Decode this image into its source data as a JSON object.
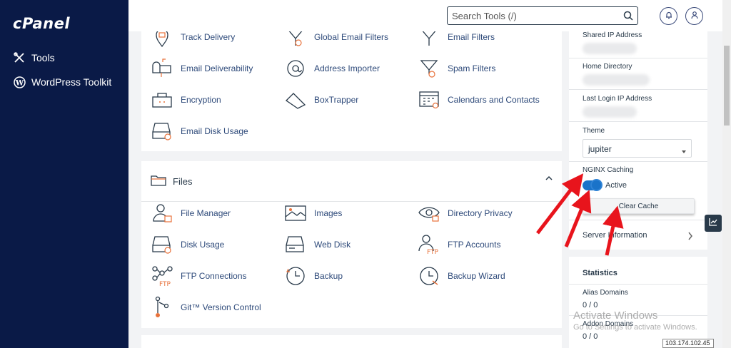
{
  "sidebar": {
    "logo": "cPanel",
    "items": [
      {
        "label": "Tools",
        "icon": "tools-icon"
      },
      {
        "label": "WordPress Toolkit",
        "icon": "wordpress-icon"
      }
    ]
  },
  "header": {
    "search_placeholder": "Search Tools (/)"
  },
  "email_tools": [
    {
      "label": "Track Delivery",
      "icon": "track-delivery-icon"
    },
    {
      "label": "Global Email Filters",
      "icon": "global-email-filters-icon"
    },
    {
      "label": "Email Filters",
      "icon": "email-filters-icon"
    },
    {
      "label": "Email Deliverability",
      "icon": "mailbox-icon"
    },
    {
      "label": "Address Importer",
      "icon": "address-importer-icon"
    },
    {
      "label": "Spam Filters",
      "icon": "spam-filters-icon"
    },
    {
      "label": "Encryption",
      "icon": "encryption-icon"
    },
    {
      "label": "BoxTrapper",
      "icon": "boxtrapper-icon"
    },
    {
      "label": "Calendars and Contacts",
      "icon": "calendar-icon"
    },
    {
      "label": "Email Disk Usage",
      "icon": "disk-usage-icon"
    }
  ],
  "files": {
    "title": "Files",
    "tools": [
      {
        "label": "File Manager",
        "icon": "file-manager-icon"
      },
      {
        "label": "Images",
        "icon": "images-icon"
      },
      {
        "label": "Directory Privacy",
        "icon": "directory-privacy-icon"
      },
      {
        "label": "Disk Usage",
        "icon": "disk-usage-icon"
      },
      {
        "label": "Web Disk",
        "icon": "web-disk-icon"
      },
      {
        "label": "FTP Accounts",
        "icon": "ftp-accounts-icon"
      },
      {
        "label": "FTP Connections",
        "icon": "ftp-connections-icon"
      },
      {
        "label": "Backup",
        "icon": "backup-icon"
      },
      {
        "label": "Backup Wizard",
        "icon": "backup-wizard-icon"
      },
      {
        "label": "Git™ Version Control",
        "icon": "git-icon"
      }
    ]
  },
  "general_info": {
    "shared_ip_label": "Shared IP Address",
    "home_dir_label": "Home Directory",
    "last_login_label": "Last Login IP Address",
    "theme_label": "Theme",
    "theme_value": "jupiter",
    "nginx_label": "NGINX Caching",
    "nginx_status": "Active",
    "clear_cache_label": "Clear Cache",
    "server_info_label": "Server Information"
  },
  "statistics": {
    "title": "Statistics",
    "items": [
      {
        "label": "Alias Domains",
        "value": "0 / 0"
      },
      {
        "label": "Addon Domains",
        "value": "0 / 0"
      }
    ]
  },
  "watermark": {
    "line1": "Activate Windows",
    "line2": "Go to Settings to activate Windows."
  },
  "ip_tooltip": "103.174.102.45",
  "colors": {
    "sidebar_bg": "#0a1a47",
    "accent": "#1a73c9",
    "annotation_arrow": "#e8141c",
    "icon_orange": "#e8723b"
  }
}
